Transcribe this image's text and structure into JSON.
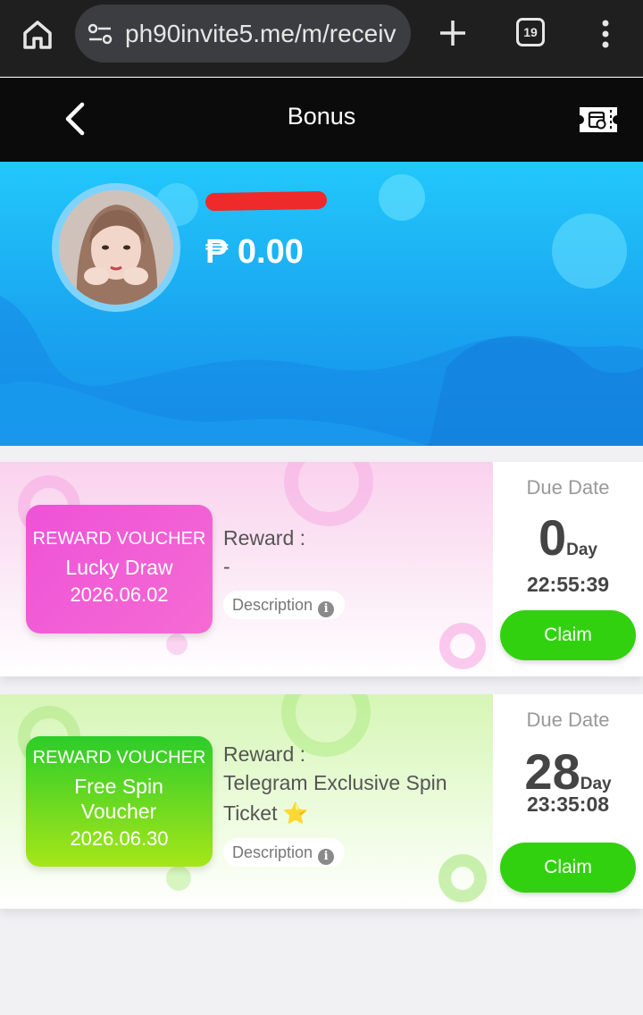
{
  "browser": {
    "url": "ph90invite5.me/m/receiv",
    "tab_count": "19"
  },
  "header": {
    "title": "Bonus"
  },
  "profile": {
    "balance": "₱ 0.00"
  },
  "vouchers": [
    {
      "type": "REWARD VOUCHER",
      "name": "Lucky Draw",
      "date": "2026.06.02",
      "reward_label": "Reward :",
      "reward_value": "-",
      "description_label": "Description",
      "due_label": "Due Date",
      "days": "0",
      "day_unit": "Day",
      "countdown": "22:55:39",
      "claim_label": "Claim",
      "color": "#f05fd6"
    },
    {
      "type": "REWARD VOUCHER",
      "name": "Free Spin Voucher",
      "date": "2026.06.30",
      "reward_label": "Reward :",
      "reward_value": "Telegram Exclusive Spin Ticket ⭐",
      "description_label": "Description",
      "due_label": "Due Date",
      "days": "28",
      "day_unit": "Day",
      "countdown": "23:35:08",
      "claim_label": "Claim",
      "color": "#5fd81f"
    }
  ],
  "colors": {
    "claim_button": "#32d10f",
    "hero_top": "#22c8fb",
    "hero_bottom": "#1590ea"
  },
  "icons": [
    "home-icon",
    "site-settings-icon",
    "plus-icon",
    "tab-switcher-icon",
    "more-vert-icon",
    "chevron-left-icon",
    "ticket-icon",
    "info-icon"
  ]
}
